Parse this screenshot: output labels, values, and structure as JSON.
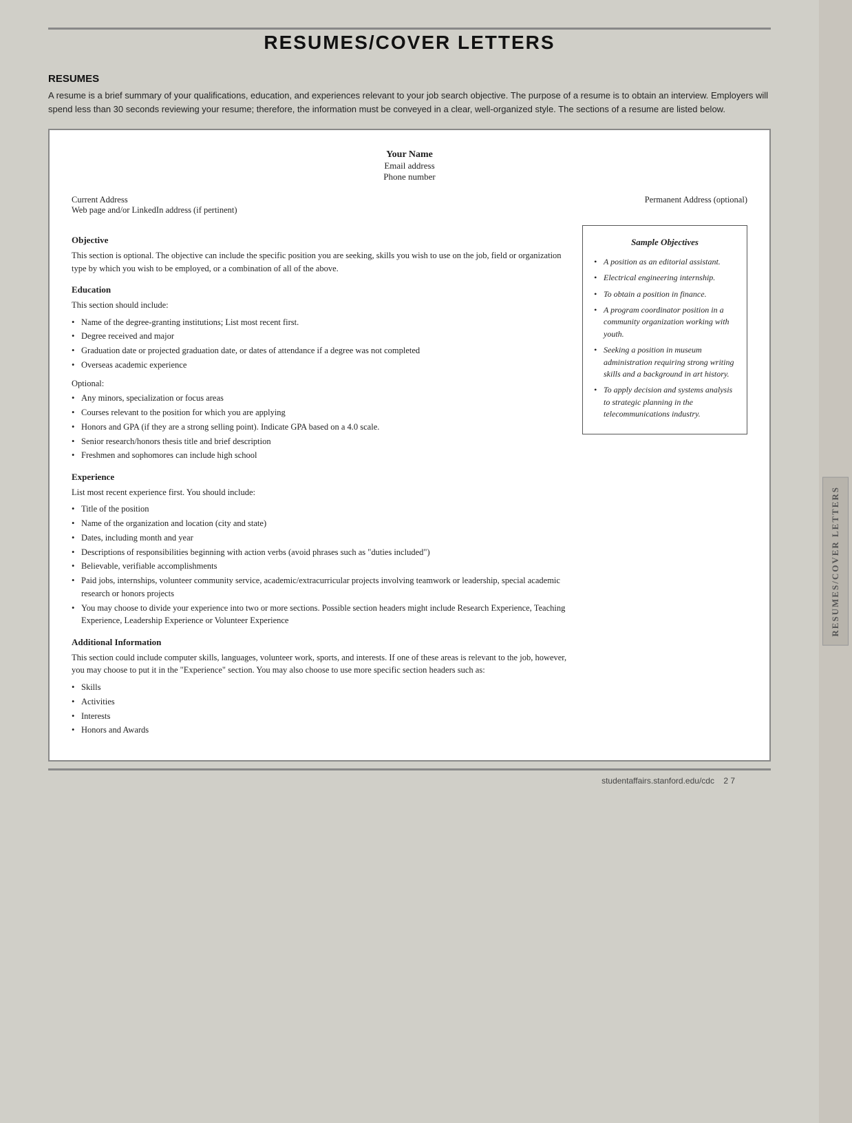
{
  "page": {
    "title": "RESUMES/COVER LETTERS",
    "footer_url": "studentaffairs.stanford.edu/cdc",
    "footer_page": "2  7"
  },
  "side_tab": {
    "label": "RESUMES/COVER LETTERS"
  },
  "resumes_section": {
    "heading": "RESUMES",
    "intro": "A resume is a brief summary of your qualifications, education, and experiences relevant to your job search objective. The purpose of a resume is to obtain an interview. Employers will spend less than 30 seconds reviewing your resume; therefore, the information must be conveyed in a clear, well-organized style. The sections of a resume are listed below."
  },
  "resume_template": {
    "name": "Your Name",
    "email": "Email address",
    "phone": "Phone number",
    "current_address": "Current Address",
    "web_address": "Web page and/or LinkedIn address (if pertinent)",
    "permanent_address": "Permanent Address (optional)"
  },
  "objective_section": {
    "title": "Objective",
    "body": "This section is optional. The objective can include the specific position you are seeking, skills you wish to use on the job, field or organization type by which you wish to be employed, or a combination of all of the above."
  },
  "sample_objectives": {
    "title": "Sample Objectives",
    "items": [
      "A position as an editorial assistant.",
      "Electrical engineering internship.",
      "To obtain a position in finance.",
      "A program coordinator position in a community organization working with youth.",
      "Seeking a position in museum administration requiring strong writing skills and a background in art history.",
      "To apply decision and systems analysis to strategic planning in the telecommunications industry."
    ]
  },
  "education_section": {
    "title": "Education",
    "intro": "This section should include:",
    "bullets": [
      "Name of the degree-granting institutions; List most recent first.",
      "Degree received and major",
      "Graduation date or projected graduation date, or dates of attendance if a degree was not completed",
      "Overseas academic experience"
    ],
    "optional_label": "Optional:",
    "optional_bullets": [
      "Any minors, specialization or focus areas",
      "Courses relevant to the position for which you are applying",
      "Honors and GPA (if they are a strong selling point). Indicate GPA based on a 4.0 scale.",
      "Senior research/honors thesis title and brief description",
      "Freshmen and sophomores can include high school"
    ]
  },
  "experience_section": {
    "title": "Experience",
    "intro": "List most recent experience first. You should include:",
    "bullets": [
      "Title of the position",
      "Name of the organization and location (city and state)",
      "Dates, including month and year",
      "Descriptions of responsibilities beginning with action verbs (avoid phrases such as \"duties included\")",
      "Believable, verifiable accomplishments",
      "Paid jobs, internships, volunteer community service, academic/extracurricular projects involving teamwork or leadership, special academic research or honors projects",
      "You may choose to divide your experience into two or more sections. Possible section headers might include Research Experience, Teaching Experience, Leadership Experience or Volunteer Experience"
    ]
  },
  "additional_section": {
    "title": "Additional Information",
    "body": "This section could include computer skills, languages, volunteer work, sports, and interests. If one of these areas is relevant to the job, however, you may choose to put it in the \"Experience\" section. You may also choose to use more specific section headers such as:",
    "bullets": [
      "Skills",
      "Activities",
      "Interests",
      "Honors and Awards"
    ]
  }
}
